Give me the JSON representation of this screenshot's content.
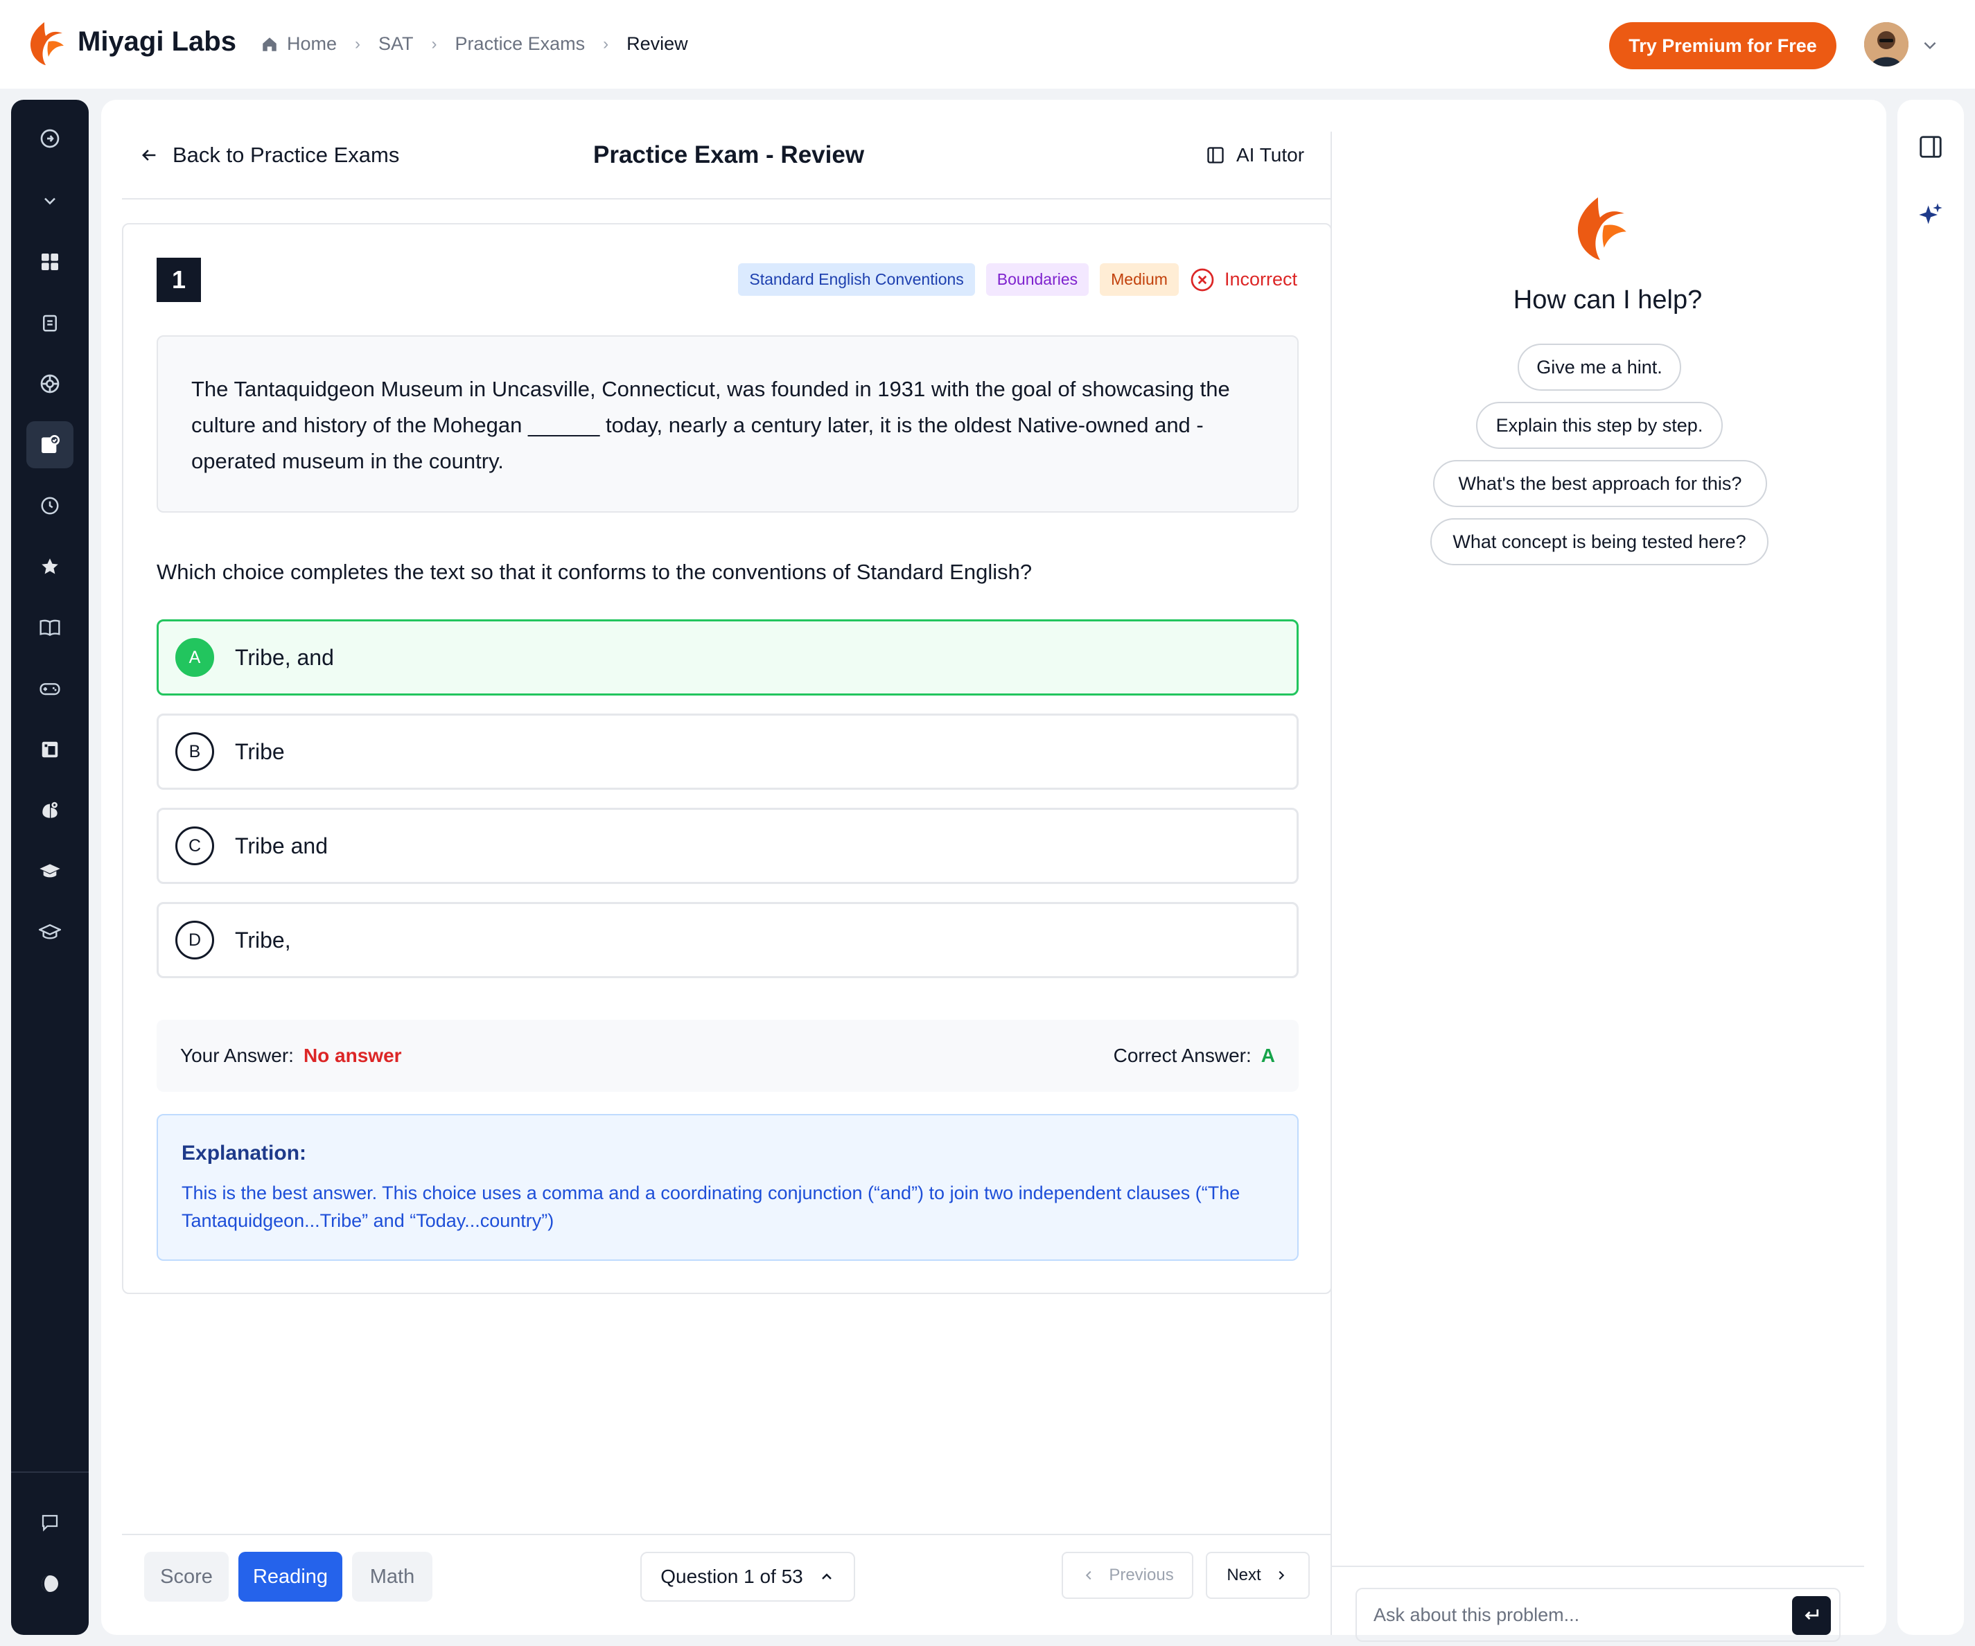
{
  "app": {
    "brand": "Miyagi Labs",
    "premium_label": "Try Premium for Free"
  },
  "breadcrumb": [
    "Home",
    "SAT",
    "Practice Exams",
    "Review"
  ],
  "header": {
    "back_label": "Back to Practice Exams",
    "title": "Practice Exam - Review",
    "ai_tutor_label": "AI Tutor"
  },
  "question": {
    "number": "1",
    "tags": [
      "Standard English Conventions",
      "Boundaries",
      "Medium"
    ],
    "status": "Incorrect",
    "passage": "The Tantaquidgeon Museum in Uncasville, Connecticut, was founded in 1931 with the goal of showcasing the culture and history of the Mohegan ______ today, nearly a century later, it is the oldest Native-owned and -operated museum in the country.",
    "prompt": "Which choice completes the text so that it conforms to the conventions of Standard English?",
    "choices": [
      {
        "letter": "A",
        "text": "Tribe, and"
      },
      {
        "letter": "B",
        "text": "Tribe"
      },
      {
        "letter": "C",
        "text": "Tribe and"
      },
      {
        "letter": "D",
        "text": "Tribe,"
      }
    ],
    "your_answer_label": "Your Answer:",
    "your_answer": "No answer",
    "correct_answer_label": "Correct Answer:",
    "correct_answer": "A",
    "explanation_title": "Explanation:",
    "explanation": "This is the best answer. This choice uses a comma and a coordinating conjunction (“and”) to join two independent clauses (“The Tantaquidgeon...Tribe” and “Today...country”)"
  },
  "footer": {
    "sections": [
      "Score",
      "Reading",
      "Math"
    ],
    "active_section": "Reading",
    "question_selector": "Question 1 of 53",
    "prev_label": "Previous",
    "next_label": "Next"
  },
  "tutor": {
    "heading": "How can I help?",
    "suggestions": [
      "Give me a hint.",
      "Explain this step by step.",
      "What's the best approach for this?",
      "What concept is being tested here?"
    ],
    "input_placeholder": "Ask about this problem..."
  },
  "sidebar_icons": [
    "expand-icon",
    "chevron-down-icon",
    "dashboard-icon",
    "clipboard-icon",
    "target-icon",
    "practice-exams-icon",
    "history-icon",
    "star-icon",
    "book-icon",
    "gamepad-icon",
    "layout-icon",
    "brain-icon",
    "graduation-cap-icon",
    "academic-icon",
    "chat-icon",
    "theme-toggle-icon"
  ],
  "colors": {
    "accent": "#ec5a13",
    "primary": "#2563eb",
    "correct": "#22c55e",
    "incorrect": "#dc2626",
    "sidebar": "#111827"
  }
}
